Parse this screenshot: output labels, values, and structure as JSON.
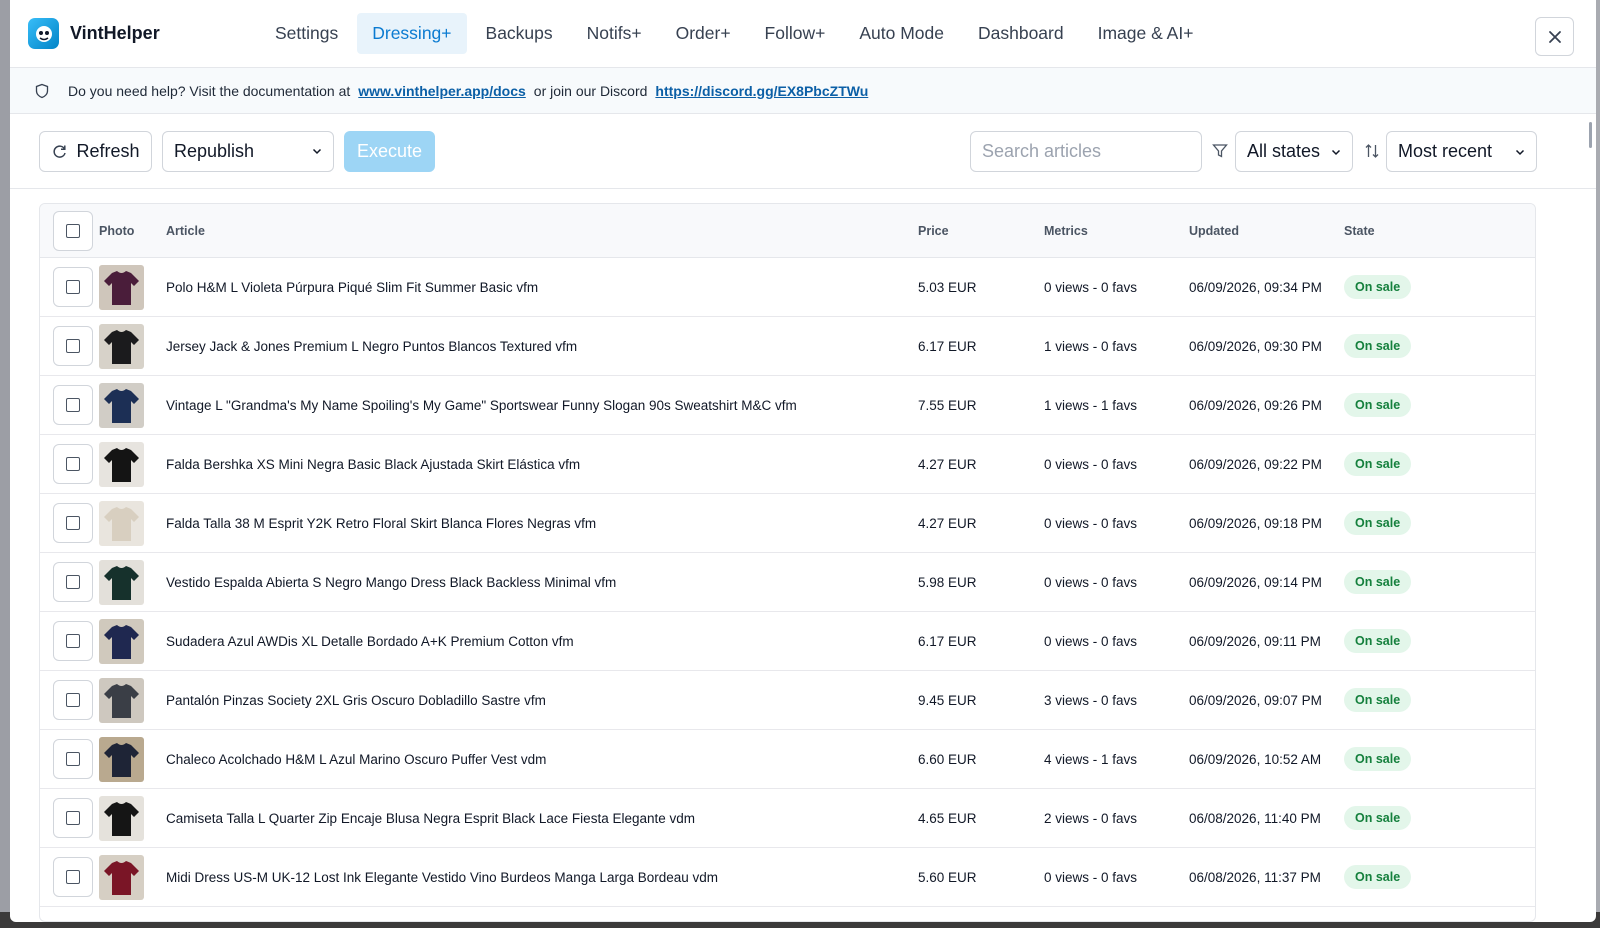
{
  "app": {
    "name": "VintHelper",
    "close_label": "×"
  },
  "nav": {
    "items": [
      "Settings",
      "Dressing+",
      "Backups",
      "Notifs+",
      "Order+",
      "Follow+",
      "Auto Mode",
      "Dashboard",
      "Image & AI+"
    ],
    "active": "Dressing+"
  },
  "info": {
    "prefix": "Do you need help? Visit the documentation at",
    "docs_link": "www.vinthelper.app/docs",
    "middle": "or join our Discord",
    "discord_link": "https://discord.gg/EX8PbcZTWu"
  },
  "toolbar": {
    "refresh_label": "Refresh",
    "action_selected": "Republish",
    "execute_label": "Execute",
    "search_placeholder": "Search articles",
    "state_filter": "All states",
    "sort": "Most recent"
  },
  "table": {
    "headers": {
      "photo": "Photo",
      "article": "Article",
      "price": "Price",
      "metrics": "Metrics",
      "updated": "Updated",
      "state": "State"
    },
    "rows": [
      {
        "title": "Polo H&M L Violeta Púrpura Piqué Slim Fit Summer Basic vfm",
        "price": "5.03 EUR",
        "metrics": "0 views - 0 favs",
        "updated": "06/09/2026, 09:34 PM",
        "state": "On sale",
        "thumb_color": "#4a1d3a",
        "thumb_bg": "#cfc6bb"
      },
      {
        "title": "Jersey Jack & Jones Premium L Negro Puntos Blancos Textured vfm",
        "price": "6.17 EUR",
        "metrics": "1 views - 0 favs",
        "updated": "06/09/2026, 09:30 PM",
        "state": "On sale",
        "thumb_color": "#1b1b1d",
        "thumb_bg": "#d7d2c9"
      },
      {
        "title": "Vintage L \"Grandma's My Name Spoiling's My Game\" Sportswear Funny Slogan 90s Sweatshirt M&C vfm",
        "price": "7.55 EUR",
        "metrics": "1 views - 1 favs",
        "updated": "06/09/2026, 09:26 PM",
        "state": "On sale",
        "thumb_color": "#1c2f55",
        "thumb_bg": "#d1cdc6"
      },
      {
        "title": "Falda Bershka XS Mini Negra Basic Black Ajustada Skirt Elástica vfm",
        "price": "4.27 EUR",
        "metrics": "0 views - 0 favs",
        "updated": "06/09/2026, 09:22 PM",
        "state": "On sale",
        "thumb_color": "#141414",
        "thumb_bg": "#e7e4df"
      },
      {
        "title": "Falda Talla 38 M Esprit Y2K Retro Floral Skirt Blanca Flores Negras vfm",
        "price": "4.27 EUR",
        "metrics": "0 views - 0 favs",
        "updated": "06/09/2026, 09:18 PM",
        "state": "On sale",
        "thumb_color": "#d8cfc0",
        "thumb_bg": "#e9e5de"
      },
      {
        "title": "Vestido Espalda Abierta S Negro Mango Dress Black Backless Minimal vfm",
        "price": "5.98 EUR",
        "metrics": "0 views - 0 favs",
        "updated": "06/09/2026, 09:14 PM",
        "state": "On sale",
        "thumb_color": "#16312c",
        "thumb_bg": "#e3e0da"
      },
      {
        "title": "Sudadera Azul AWDis XL Detalle Bordado A+K Premium Cotton vfm",
        "price": "6.17 EUR",
        "metrics": "0 views - 0 favs",
        "updated": "06/09/2026, 09:11 PM",
        "state": "On sale",
        "thumb_color": "#1f2850",
        "thumb_bg": "#d0c9bd"
      },
      {
        "title": "Pantalón Pinzas Society 2XL Gris Oscuro Dobladillo Sastre vfm",
        "price": "9.45 EUR",
        "metrics": "3 views - 0 favs",
        "updated": "06/09/2026, 09:07 PM",
        "state": "On sale",
        "thumb_color": "#3a3e46",
        "thumb_bg": "#cec8bf"
      },
      {
        "title": "Chaleco Acolchado H&M L Azul Marino Oscuro Puffer Vest vdm",
        "price": "6.60 EUR",
        "metrics": "4 views - 1 favs",
        "updated": "06/09/2026, 10:52 AM",
        "state": "On sale",
        "thumb_color": "#1e2436",
        "thumb_bg": "#b9a98f"
      },
      {
        "title": "Camiseta Talla L Quarter Zip Encaje Blusa Negra Esprit Black Lace Fiesta Elegante vdm",
        "price": "4.65 EUR",
        "metrics": "2 views - 0 favs",
        "updated": "06/08/2026, 11:40 PM",
        "state": "On sale",
        "thumb_color": "#151515",
        "thumb_bg": "#e5e2dc"
      },
      {
        "title": "Midi Dress US-M UK-12 Lost Ink Elegante Vestido Vino Burdeos Manga Larga Bordeau vdm",
        "price": "5.60 EUR",
        "metrics": "0 views - 0 favs",
        "updated": "06/08/2026, 11:37 PM",
        "state": "On sale",
        "thumb_color": "#7a1526",
        "thumb_bg": "#d6cfc4"
      }
    ]
  }
}
